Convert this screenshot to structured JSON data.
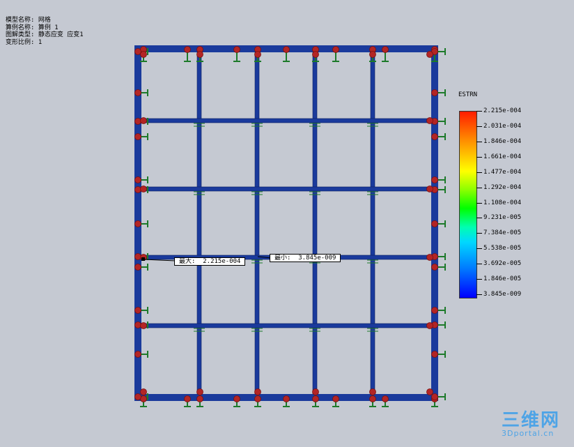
{
  "info": {
    "model_name": "模型名称: 网格",
    "study_name": "算例名称: 算例 1",
    "plot_type": "图解类型: 静态应变 应变1",
    "deform_scale": "变形比例: 1"
  },
  "legend": {
    "title": "ESTRN",
    "labels": [
      "2.215e-004",
      "2.031e-004",
      "1.846e-004",
      "1.661e-004",
      "1.477e-004",
      "1.292e-004",
      "1.108e-004",
      "9.231e-005",
      "7.384e-005",
      "5.538e-005",
      "3.692e-005",
      "1.846e-005",
      "3.845e-009"
    ],
    "max_color": "#ff1d00",
    "min_color": "#0000ff"
  },
  "probes": {
    "max_label": "最大:  2.215e-004",
    "min_label": "最小:  3.845e-009"
  },
  "colors": {
    "beam": "#1a3a9c",
    "fixture": "#1d7a2a",
    "joint": "#b32525",
    "background": "#c5c9d2"
  },
  "watermark": {
    "main": "三维网",
    "sub": "3Dportal.cn"
  }
}
